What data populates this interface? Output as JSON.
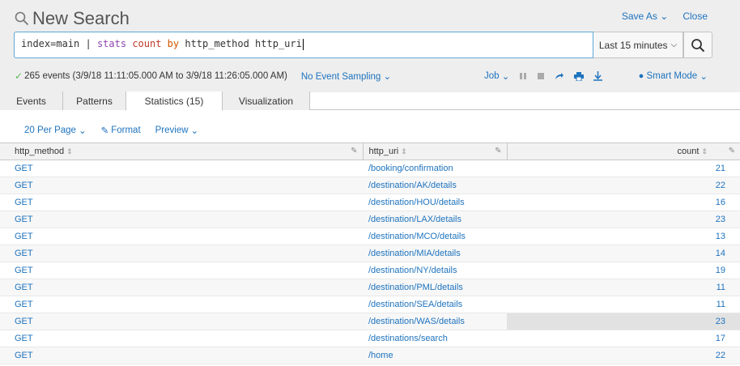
{
  "header": {
    "title": "New Search",
    "save_as": "Save As",
    "close": "Close"
  },
  "search": {
    "query_index": "index=main",
    "query_pipe": "|",
    "query_stats": "stats",
    "query_count": "count",
    "query_by": "by",
    "query_fields": "http_method http_uri",
    "time_range": "Last 15 minutes"
  },
  "status": {
    "events": "265 events (3/9/18 11:11:05.000 AM to 3/9/18 11:26:05.000 AM)",
    "sampling": "No Event Sampling",
    "job": "Job",
    "mode": "Smart Mode"
  },
  "tabs": [
    {
      "label": "Events"
    },
    {
      "label": "Patterns"
    },
    {
      "label": "Statistics (15)"
    },
    {
      "label": "Visualization"
    }
  ],
  "controls": {
    "per_page": "20 Per Page",
    "format": "Format",
    "preview": "Preview"
  },
  "table": {
    "columns": [
      "http_method",
      "http_uri",
      "count"
    ],
    "rows": [
      [
        "GET",
        "/booking/confirmation",
        "21"
      ],
      [
        "GET",
        "/destination/AK/details",
        "22"
      ],
      [
        "GET",
        "/destination/HOU/details",
        "16"
      ],
      [
        "GET",
        "/destination/LAX/details",
        "23"
      ],
      [
        "GET",
        "/destination/MCO/details",
        "13"
      ],
      [
        "GET",
        "/destination/MIA/details",
        "14"
      ],
      [
        "GET",
        "/destination/NY/details",
        "19"
      ],
      [
        "GET",
        "/destination/PML/details",
        "11"
      ],
      [
        "GET",
        "/destination/SEA/details",
        "11"
      ],
      [
        "GET",
        "/destination/WAS/details",
        "23"
      ],
      [
        "GET",
        "/destinations/search",
        "17"
      ],
      [
        "GET",
        "/home",
        "22"
      ]
    ]
  },
  "colors": {
    "link": "#1e73be",
    "accent_border": "#5fa8d8",
    "success": "#5cb85c"
  }
}
